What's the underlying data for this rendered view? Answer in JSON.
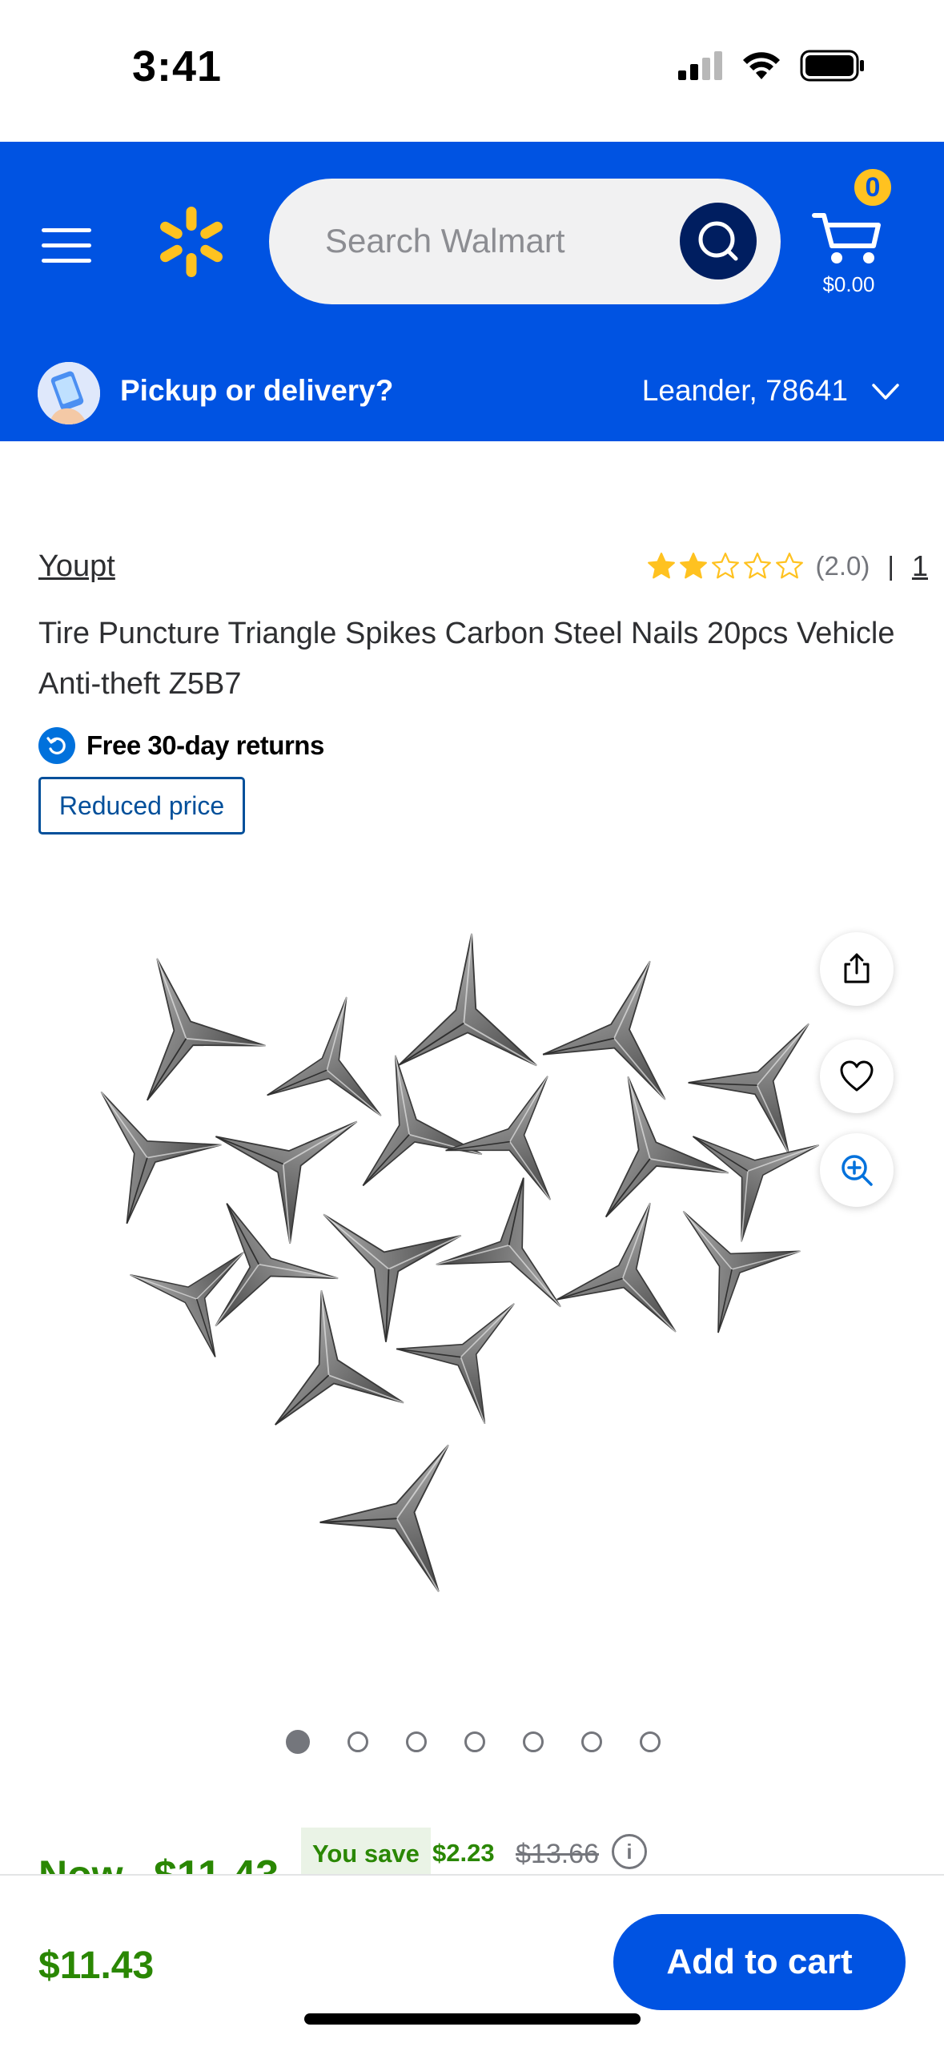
{
  "status_bar": {
    "time": "3:41"
  },
  "header": {
    "search": {
      "placeholder": "Search Walmart"
    },
    "cart": {
      "count": "0",
      "total": "$0.00"
    },
    "pickup": {
      "label": "Pickup or delivery?",
      "location": "Leander, 78641"
    },
    "brand_colors": {
      "primary": "#0053e2",
      "spark": "#ffc220",
      "search_button": "#001e60"
    }
  },
  "product": {
    "brand": "Youpt",
    "rating": {
      "value": 2.0,
      "stars_filled": 2,
      "stars_total": 5,
      "display": "(2.0)",
      "separator": "|",
      "review_count": "1"
    },
    "title": "Tire Puncture Triangle Spikes Carbon Steel Nails 20pcs Vehicle Anti-theft Z5B7",
    "returns": "Free 30-day returns",
    "badge": "Reduced price",
    "image_alt": "triangle-spikes-image",
    "carousel": {
      "total": 7,
      "active_index": 0
    }
  },
  "price": {
    "now_label": "Now",
    "now_price": "$11.43",
    "save_label": "You save",
    "save_amount": "$2.23",
    "was_price": "$13.66"
  },
  "bottom_bar": {
    "price": "$11.43",
    "add_to_cart": "Add to cart"
  }
}
